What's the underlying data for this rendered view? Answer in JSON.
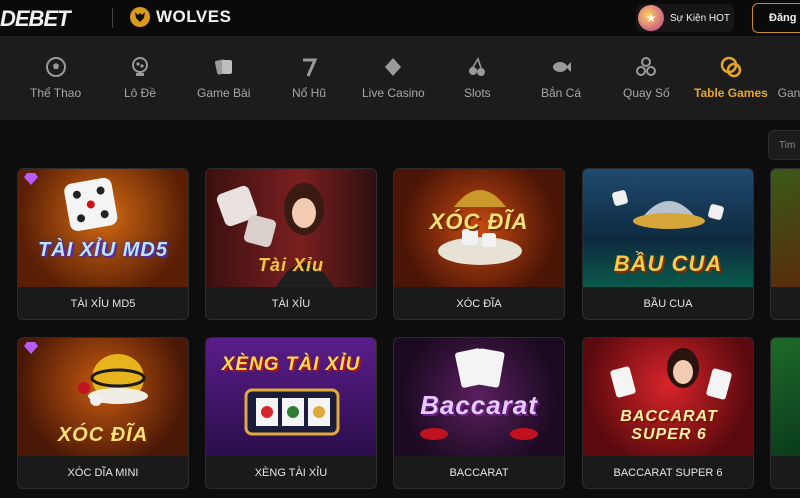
{
  "header": {
    "logo": "DEBET",
    "partner": "WOLVES",
    "hot_event": "Sự Kiện HOT",
    "login": "Đăng"
  },
  "nav": {
    "items": [
      {
        "label": "Thể Thao",
        "icon": "soccer-ball-icon"
      },
      {
        "label": "Lô Đề",
        "icon": "lottery-machine-icon"
      },
      {
        "label": "Game Bài",
        "icon": "cards-icon"
      },
      {
        "label": "Nổ Hũ",
        "icon": "slot-seven-icon"
      },
      {
        "label": "Live Casino",
        "icon": "diamond-suit-icon"
      },
      {
        "label": "Slots",
        "icon": "cherries-icon"
      },
      {
        "label": "Bắn Cá",
        "icon": "fish-icon"
      },
      {
        "label": "Quay Số",
        "icon": "lottery-balls-icon"
      },
      {
        "label": "Table Games",
        "icon": "chip-icon",
        "active": true
      },
      {
        "label": "Gan",
        "icon": ""
      }
    ],
    "accent": "#e6a626"
  },
  "search": {
    "text": "Tim"
  },
  "games": [
    {
      "label": "TÀI XỈU MD5",
      "art": "TÀI XỈU MD5"
    },
    {
      "label": "TÀI XỈU",
      "art": "Tài Xỉu"
    },
    {
      "label": "XÓC ĐĨA",
      "art": "XÓC ĐĨA"
    },
    {
      "label": "BẦU CUA",
      "art": "BẦU CUA"
    },
    {
      "label": "XÓC DĨA MINI",
      "art": "XÓC ĐĨA"
    },
    {
      "label": "XÈNG TÀI XỈU",
      "art": "XÈNG TÀI XỈU"
    },
    {
      "label": "BACCARAT",
      "art": "Baccarat"
    },
    {
      "label": "BACCARAT SUPER 6",
      "art": "BACCARAT SUPER 6"
    }
  ]
}
